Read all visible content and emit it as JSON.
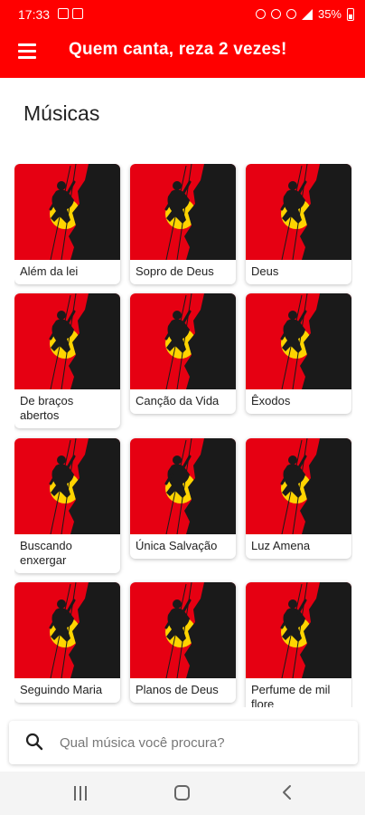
{
  "status": {
    "time": "17:33",
    "battery": "35%"
  },
  "header": {
    "title": "Quem canta, reza 2 vezes!"
  },
  "section": {
    "title": "Músicas"
  },
  "songs": [
    {
      "label": "Além da lei"
    },
    {
      "label": "Sopro de Deus"
    },
    {
      "label": "Deus"
    },
    {
      "label": "De braços abertos"
    },
    {
      "label": "Canção da Vida"
    },
    {
      "label": "Êxodos"
    },
    {
      "label": "Buscando enxergar"
    },
    {
      "label": "Única Salvação"
    },
    {
      "label": "Luz Amena"
    },
    {
      "label": "Seguindo Maria"
    },
    {
      "label": "Planos de Deus"
    },
    {
      "label": "Perfume de mil flore"
    }
  ],
  "search": {
    "placeholder": "Qual música você procura?"
  },
  "colors": {
    "brand": "#ff0000",
    "artwork_red": "#e60012",
    "artwork_sun": "#ffd400",
    "artwork_dark": "#1a1a1a"
  }
}
